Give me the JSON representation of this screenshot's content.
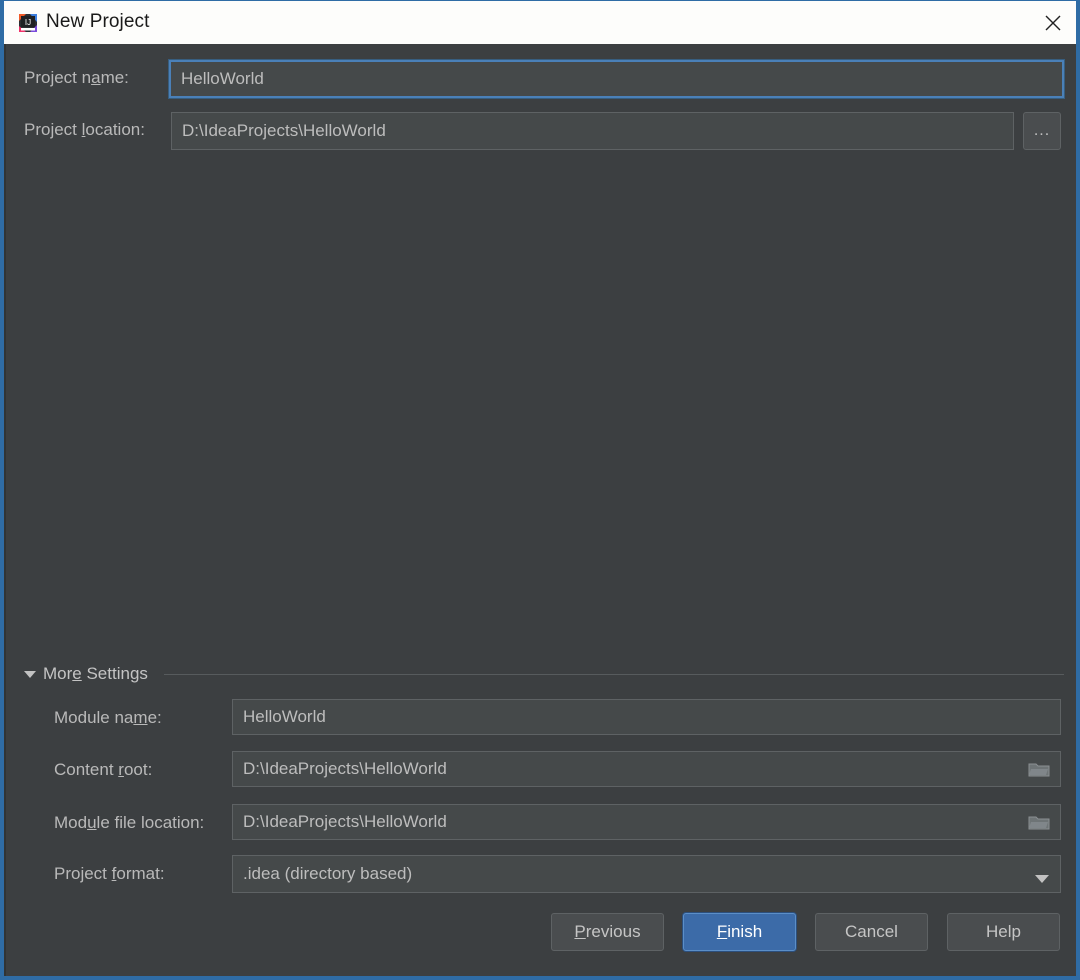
{
  "window": {
    "title": "New Project",
    "app_icon": "intellij-idea-icon",
    "close_icon": "close-icon",
    "accent_border_color": "#2f6ca5",
    "background_color": "#3c3f41",
    "titlebar_background_color": "#fdfdfb"
  },
  "main": {
    "project_name": {
      "label_prefix": "Project n",
      "label_mnemonic": "a",
      "label_suffix": "me:",
      "value": "HelloWorld",
      "focused": true
    },
    "project_location": {
      "label_prefix": "Project ",
      "label_mnemonic": "l",
      "label_suffix": "ocation:",
      "value": "D:\\IdeaProjects\\HelloWorld",
      "browse_label": "..."
    }
  },
  "more_settings": {
    "label_prefix": "Mor",
    "label_mnemonic": "e",
    "label_suffix": " Settings",
    "expanded": true,
    "triangle_icon": "chevron-down-icon",
    "fields": [
      {
        "name": "module-name",
        "label_prefix": "Module na",
        "label_mnemonic": "m",
        "label_suffix": "e:",
        "value": "HelloWorld",
        "icon": "none"
      },
      {
        "name": "content-root",
        "label_prefix": "Content ",
        "label_mnemonic": "r",
        "label_suffix": "oot:",
        "value": "D:\\IdeaProjects\\HelloWorld",
        "icon": "folder-icon"
      },
      {
        "name": "module-file-location",
        "label_prefix": "Mod",
        "label_mnemonic": "u",
        "label_suffix": "le file location:",
        "value": "D:\\IdeaProjects\\HelloWorld",
        "icon": "folder-icon"
      },
      {
        "name": "project-format",
        "label_prefix": "Project ",
        "label_mnemonic": "f",
        "label_suffix": "ormat:",
        "value": ".idea (directory based)",
        "icon": "chevron-down-icon"
      }
    ]
  },
  "footer": {
    "buttons": [
      {
        "name": "previous",
        "prefix": "",
        "mnemonic": "P",
        "suffix": "revious",
        "primary": false
      },
      {
        "name": "finish",
        "prefix": "",
        "mnemonic": "F",
        "suffix": "inish",
        "primary": true
      },
      {
        "name": "cancel",
        "prefix": "Cancel",
        "mnemonic": "",
        "suffix": "",
        "primary": false
      },
      {
        "name": "help",
        "prefix": "Help",
        "mnemonic": "",
        "suffix": "",
        "primary": false
      }
    ]
  }
}
